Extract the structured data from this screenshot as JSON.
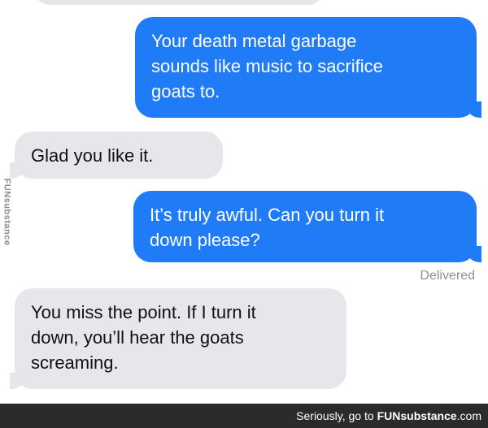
{
  "messages": [
    {
      "text": "Your death metal garbage\nsounds like music to sacrifice\ngoats to."
    },
    {
      "text": "Glad you like it."
    },
    {
      "text": "It’s truly awful. Can you turn it\ndown please?"
    },
    {
      "text": "You miss the point. If I turn it\ndown, you’ll hear the goats\nscreaming."
    }
  ],
  "status": "Delivered",
  "watermark": {
    "side": "FUNsubstance",
    "footer_prefix": "Seriously, go to",
    "footer_brand": "FUNsubstance",
    "footer_suffix": ".com"
  },
  "colors": {
    "sent_bubble": "#1f7cf6",
    "received_bubble": "#e6e6eb",
    "footer_bar": "#2b2b2b"
  }
}
